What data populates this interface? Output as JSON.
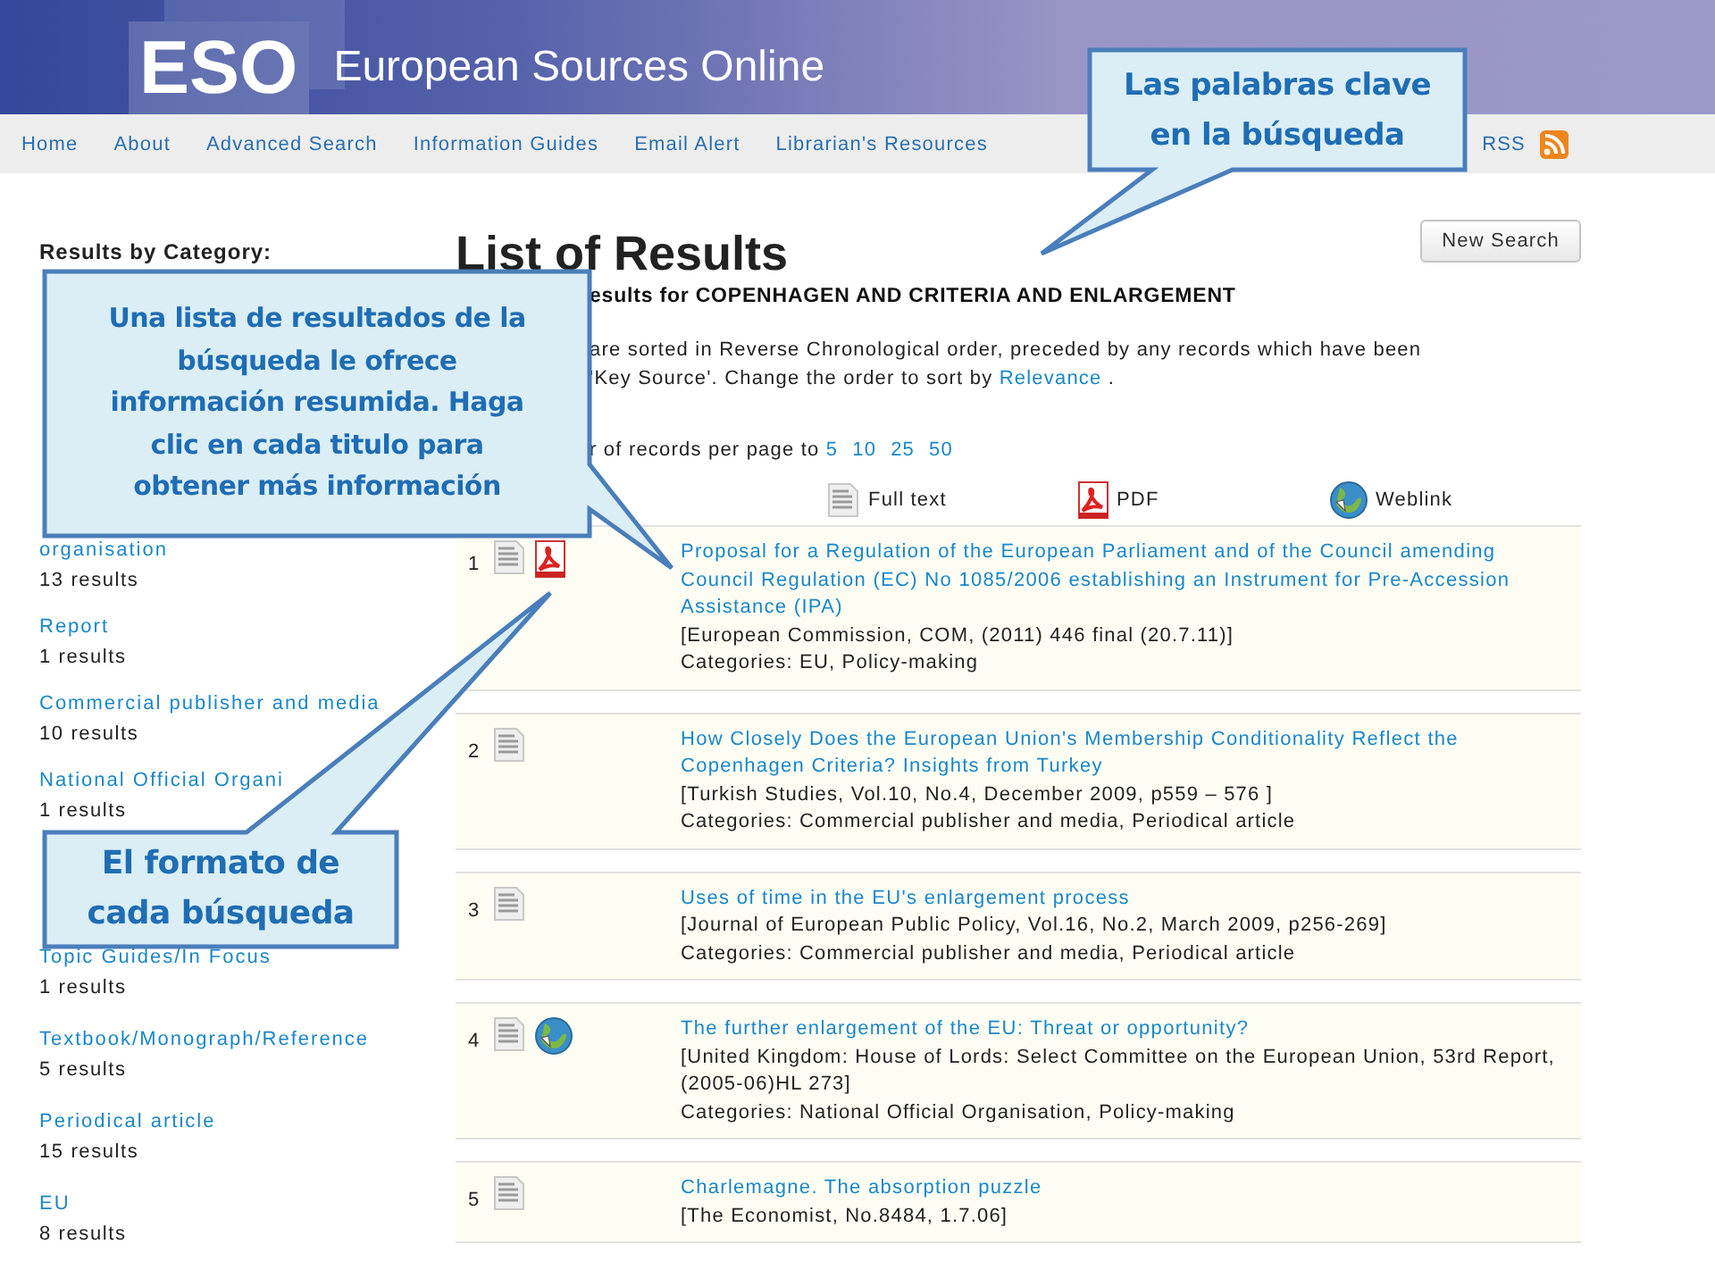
{
  "header": {
    "logo": "ESO",
    "site_name": "European Sources Online"
  },
  "nav": {
    "links": [
      "Home",
      "About",
      "Advanced Search",
      "Information Guides",
      "Email Alert",
      "Librarian's Resources"
    ],
    "rss": "RSS"
  },
  "sidebar": {
    "heading": "Results by Category:",
    "categories": [
      {
        "name": "organisation",
        "count": "13 results"
      },
      {
        "name": "Report",
        "count": "1 results"
      },
      {
        "name": "Commercial publisher and media",
        "count": "10 results"
      },
      {
        "name": "National Official Organi",
        "count": "1 results"
      }
    ],
    "categories_below_callout": [
      {
        "name": "Topic Guides/In Focus",
        "count": "1 results"
      },
      {
        "name": "Textbook/Monograph/Reference",
        "count": "5 results"
      },
      {
        "name": "Periodical article",
        "count": "15 results"
      },
      {
        "name": "EU",
        "count": "8 results"
      }
    ]
  },
  "main": {
    "title": "List of Results",
    "new_search": "New Search",
    "query_line": "esults for COPENHAGEN AND CRITERIA AND ENLARGEMENT",
    "sort_line_1": "are sorted in Reverse Chronological order, preceded by any records which have been",
    "sort_line_2": "'Key Source'. Change the order to sort by",
    "sort_link": "Relevance",
    "sort_end": ".",
    "per_page_text": "r of records per page to",
    "per_page_options": [
      "5",
      "10",
      "25",
      "50"
    ],
    "legend": [
      {
        "kind": "fulltext",
        "label": "Full text"
      },
      {
        "kind": "pdf",
        "label": "PDF"
      },
      {
        "kind": "weblink",
        "label": "Weblink"
      }
    ],
    "results": [
      {
        "number": "1",
        "formats": [
          {
            "kind": "fulltext"
          },
          {
            "kind": "pdf"
          }
        ],
        "title": "Proposal for a Regulation of the European Parliament and of the Council amending Council Regulation (EC) No 1085/2006 establishing an Instrument for Pre-Accession Assistance (IPA)",
        "source": "[European Commission, COM, (2011) 446 final (20.7.11)]",
        "categories": "Categories: EU, Policy-making"
      },
      {
        "number": "2",
        "formats": [
          {
            "kind": "fulltext"
          }
        ],
        "title": "How Closely Does the European Union's Membership Conditionality Reflect the Copenhagen Criteria? Insights from Turkey",
        "source": "[Turkish Studies, Vol.10, No.4, December 2009, p559 – 576 ]",
        "categories": "Categories: Commercial publisher and media, Periodical article"
      },
      {
        "number": "3",
        "formats": [
          {
            "kind": "fulltext"
          }
        ],
        "title": "Uses of time in the EU's enlargement process",
        "source": "[Journal of European Public Policy, Vol.16, No.2, March 2009, p256-269]",
        "categories": "Categories: Commercial publisher and media, Periodical article"
      },
      {
        "number": "4",
        "formats": [
          {
            "kind": "fulltext"
          },
          {
            "kind": "weblink"
          }
        ],
        "title": "The further enlargement of the EU: Threat or opportunity?",
        "source": "[United Kingdom: House of Lords: Select Committee on the European Union, 53rd Report, (2005-06)HL 273]",
        "categories": "Categories: National Official Organisation, Policy-making"
      },
      {
        "number": "5",
        "formats": [
          {
            "kind": "fulltext"
          }
        ],
        "title": "Charlemagne. The absorption puzzle",
        "source": "[The Economist, No.8484, 1.7.06]"
      }
    ]
  },
  "callouts": [
    {
      "lines": [
        "Las palabras clave",
        "en la búsqueda"
      ]
    },
    {
      "lines": [
        "Una lista de resultados de la",
        "búsqueda le ofrece",
        "información resumida. Haga",
        "clic en cada titulo para",
        "obtener más información"
      ]
    },
    {
      "lines": [
        "El formato de",
        "cada búsqueda"
      ]
    }
  ]
}
